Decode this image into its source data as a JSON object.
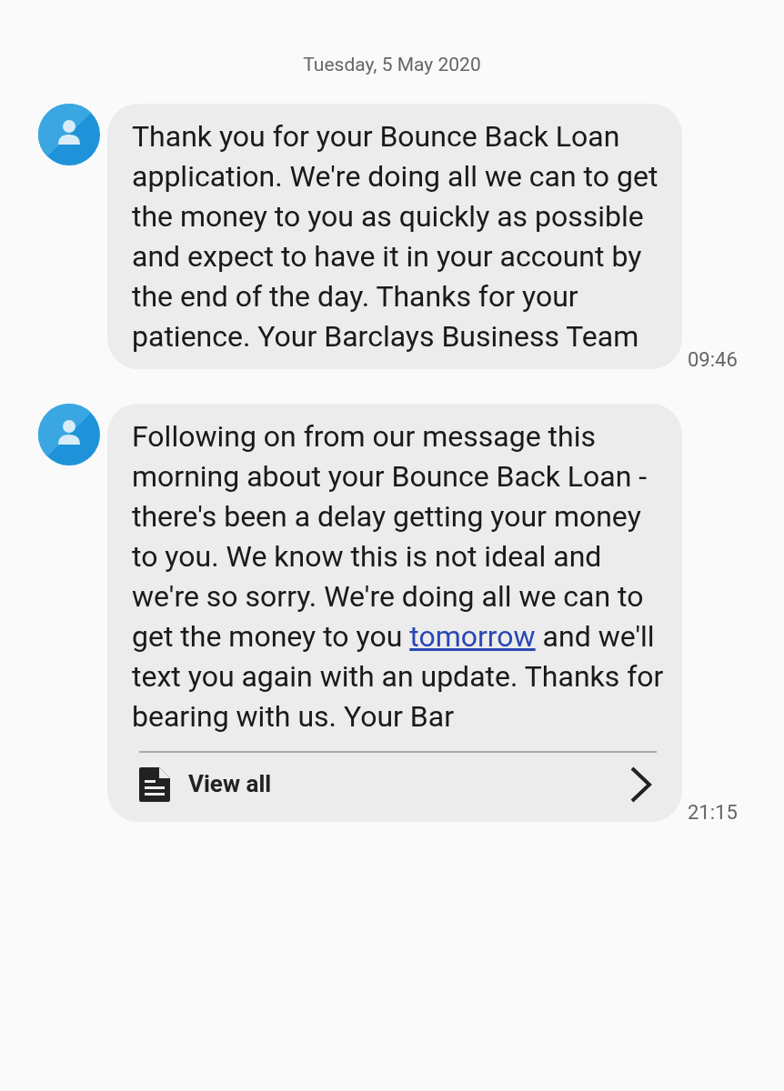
{
  "date_header": "Tuesday, 5 May 2020",
  "messages": [
    {
      "text_before": "Thank you for your Bounce Back Loan application. We're doing all we can to get the money to you as quickly as possible and expect to have it in your account by the end of the day. Thanks for your patience. Your Barclays Business Team",
      "time": "09:46"
    },
    {
      "text_before": "Following on from our message this morning about your Bounce Back Loan - there's been a delay getting your money to you. We know this is not ideal and we're so sorry. We're doing all we can to get the money to you ",
      "link": "tomorrow",
      "text_after": " and we'll text you again with an update. Thanks for bearing with us. Your Bar",
      "view_all": "View all",
      "time": "21:15"
    }
  ]
}
